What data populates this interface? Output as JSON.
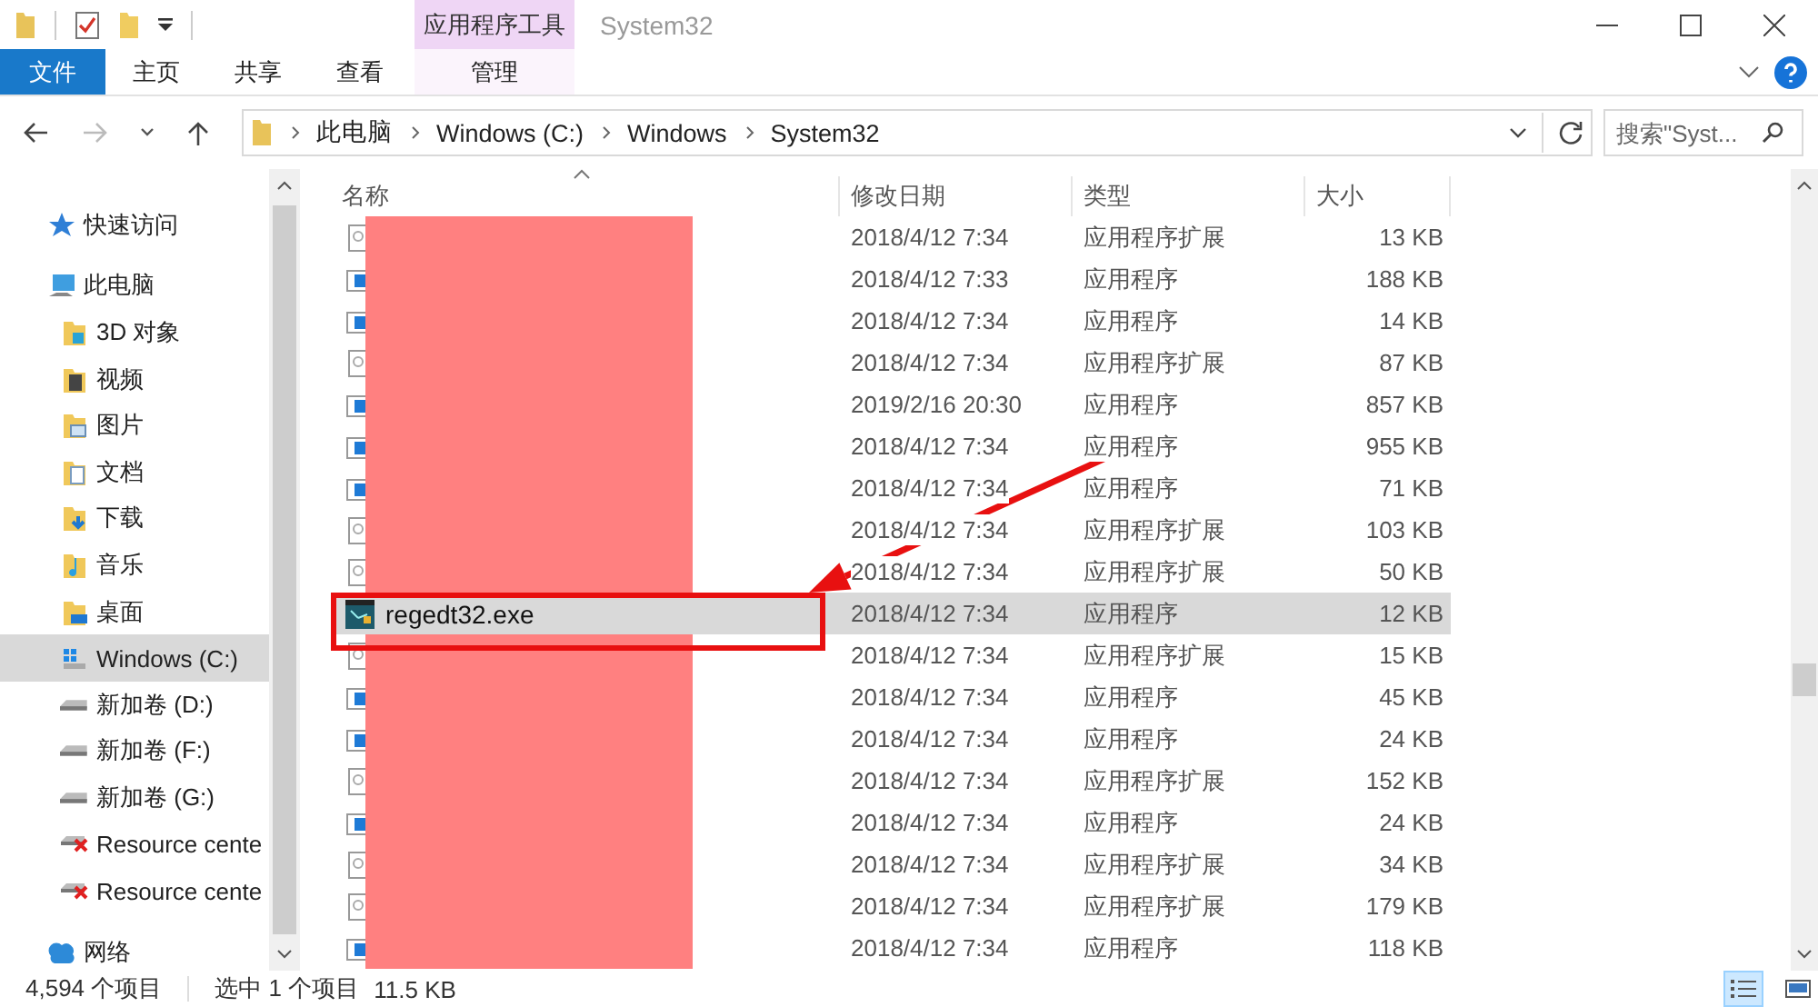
{
  "window": {
    "context_tab_group": "应用程序工具",
    "title": "System32"
  },
  "ribbon_tabs": [
    {
      "label": "文件",
      "kind": "file"
    },
    {
      "label": "主页",
      "kind": "normal"
    },
    {
      "label": "共享",
      "kind": "normal"
    },
    {
      "label": "查看",
      "kind": "normal"
    },
    {
      "label": "管理",
      "kind": "context"
    }
  ],
  "address_bar": {
    "breadcrumbs": [
      "此电脑",
      "Windows (C:)",
      "Windows",
      "System32"
    ]
  },
  "search": {
    "placeholder": "搜索\"Syst..."
  },
  "sidebar": {
    "items": [
      {
        "label": "快速访问",
        "kind": "star",
        "selected": false
      },
      {
        "label": "此电脑",
        "kind": "pc",
        "selected": false,
        "children": [
          {
            "label": "3D 对象",
            "kind": "cube",
            "selected": false
          },
          {
            "label": "视频",
            "kind": "video",
            "selected": false
          },
          {
            "label": "图片",
            "kind": "picture-folder",
            "selected": false
          },
          {
            "label": "文档",
            "kind": "document",
            "selected": false
          },
          {
            "label": "下载",
            "kind": "download",
            "selected": false
          },
          {
            "label": "音乐",
            "kind": "music",
            "selected": false
          },
          {
            "label": "桌面",
            "kind": "desktop",
            "selected": false
          },
          {
            "label": "Windows (C:)",
            "kind": "system-drive",
            "selected": true
          },
          {
            "label": "新加卷 (D:)",
            "kind": "drive",
            "selected": false
          },
          {
            "label": "新加卷 (F:)",
            "kind": "drive",
            "selected": false
          },
          {
            "label": "新加卷 (G:)",
            "kind": "drive",
            "selected": false
          },
          {
            "label": "Resource cente",
            "kind": "network-drive",
            "selected": false
          },
          {
            "label": "Resource cente",
            "kind": "network-drive",
            "selected": false
          }
        ]
      },
      {
        "label": "网络",
        "kind": "network",
        "selected": false
      }
    ]
  },
  "table": {
    "columns": [
      "名称",
      "修改日期",
      "类型",
      "大小"
    ],
    "rows": [
      {
        "kind": "extension",
        "modified": "2018/4/12 7:34",
        "type": "应用程序扩展",
        "size": "13 KB",
        "selected": false
      },
      {
        "kind": "app",
        "modified": "2018/4/12 7:33",
        "type": "应用程序",
        "size": "188 KB",
        "selected": false
      },
      {
        "kind": "app",
        "modified": "2018/4/12 7:34",
        "type": "应用程序",
        "size": "14 KB",
        "selected": false
      },
      {
        "kind": "extension",
        "modified": "2018/4/12 7:34",
        "type": "应用程序扩展",
        "size": "87 KB",
        "selected": false
      },
      {
        "kind": "app",
        "modified": "2019/2/16 20:30",
        "type": "应用程序",
        "size": "857 KB",
        "selected": false
      },
      {
        "kind": "app",
        "modified": "2018/4/12 7:34",
        "type": "应用程序",
        "size": "955 KB",
        "selected": false
      },
      {
        "kind": "app",
        "modified": "2018/4/12 7:34",
        "type": "应用程序",
        "size": "71 KB",
        "selected": false
      },
      {
        "kind": "extension",
        "modified": "2018/4/12 7:34",
        "type": "应用程序扩展",
        "size": "103 KB",
        "selected": false
      },
      {
        "kind": "extension",
        "modified": "2018/4/12 7:34",
        "type": "应用程序扩展",
        "size": "50 KB",
        "selected": false
      },
      {
        "kind": "registry",
        "name": "regedt32.exe",
        "modified": "2018/4/12 7:34",
        "type": "应用程序",
        "size": "12 KB",
        "selected": true
      },
      {
        "kind": "extension",
        "modified": "2018/4/12 7:34",
        "type": "应用程序扩展",
        "size": "15 KB",
        "selected": false
      },
      {
        "kind": "app",
        "modified": "2018/4/12 7:34",
        "type": "应用程序",
        "size": "45 KB",
        "selected": false
      },
      {
        "kind": "app",
        "modified": "2018/4/12 7:34",
        "type": "应用程序",
        "size": "24 KB",
        "selected": false
      },
      {
        "kind": "extension",
        "modified": "2018/4/12 7:34",
        "type": "应用程序扩展",
        "size": "152 KB",
        "selected": false
      },
      {
        "kind": "app",
        "modified": "2018/4/12 7:34",
        "type": "应用程序",
        "size": "24 KB",
        "selected": false
      },
      {
        "kind": "extension",
        "modified": "2018/4/12 7:34",
        "type": "应用程序扩展",
        "size": "34 KB",
        "selected": false
      },
      {
        "kind": "extension",
        "modified": "2018/4/12 7:34",
        "type": "应用程序扩展",
        "size": "179 KB",
        "selected": false
      },
      {
        "kind": "app",
        "modified": "2018/4/12 7:34",
        "type": "应用程序",
        "size": "118 KB",
        "selected": false
      }
    ]
  },
  "status_bar": {
    "item_count": "4,594 个项目",
    "selection": "选中 1 个项目",
    "selection_size": "11.5 KB"
  },
  "view_buttons": [
    {
      "kind": "details",
      "selected": true
    },
    {
      "kind": "large-icons",
      "selected": false
    }
  ]
}
